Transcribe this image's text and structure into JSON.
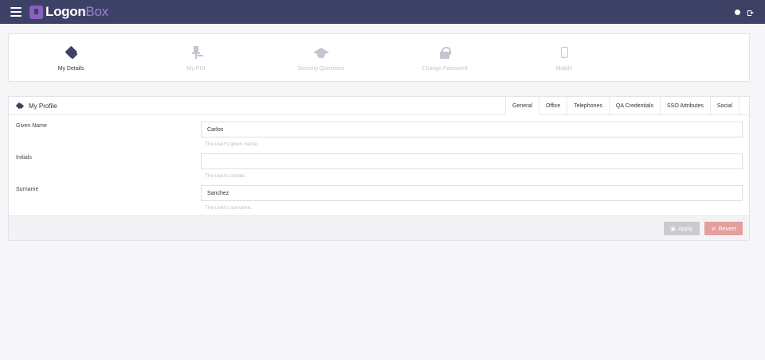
{
  "brand": {
    "name_main": "Logon",
    "name_accent": "Box"
  },
  "tiles": [
    {
      "label": "My Details",
      "icon": "tag-icon",
      "active": true
    },
    {
      "label": "My PIN",
      "icon": "pin-icon",
      "active": false
    },
    {
      "label": "Security Questions",
      "icon": "graduation-cap-icon",
      "active": false
    },
    {
      "label": "Change Password",
      "icon": "lock-icon",
      "active": false
    },
    {
      "label": "Mobile",
      "icon": "mobile-icon",
      "active": false
    }
  ],
  "profile": {
    "title": "My Profile",
    "tabs": [
      "General",
      "Office",
      "Telephones",
      "QA Credentials",
      "SSO Attributes",
      "Social"
    ],
    "fields": [
      {
        "label": "Given Name",
        "value": "Carlos",
        "help": "The user's given name."
      },
      {
        "label": "Initials",
        "value": "",
        "help": "The user's initials."
      },
      {
        "label": "Surname",
        "value": "Sanchez",
        "help": "The user's surname."
      }
    ],
    "apply_label": "Apply",
    "revert_label": "Revert"
  },
  "colors": {
    "navbar": "#3e4166",
    "accent": "#8b5fbf",
    "apply": "#cacbd0",
    "revert": "#e49e9b"
  }
}
